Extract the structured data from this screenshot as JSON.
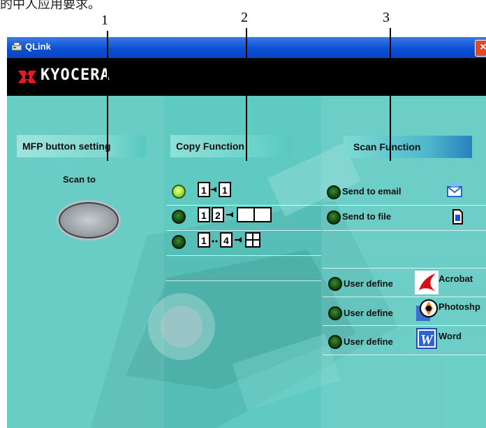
{
  "annotations": {
    "top_text": "的中人应用要求。",
    "callouts": [
      "1",
      "2",
      "3"
    ]
  },
  "window": {
    "title": "QLink",
    "close_symbol": "×"
  },
  "brand": {
    "name": "KYOCERA"
  },
  "sections": {
    "mfp": {
      "header": "MFP button setting",
      "scan_label": "Scan to"
    },
    "copy": {
      "header": "Copy Function",
      "items": [
        {
          "name": "copy-1-to-1",
          "state": "on"
        },
        {
          "name": "copy-2-in-1",
          "state": "off"
        },
        {
          "name": "copy-4-in-1",
          "state": "off"
        }
      ],
      "icon_digits": {
        "one": "1",
        "two": "2",
        "four": "4"
      }
    },
    "scan": {
      "header": "Scan Function",
      "items": [
        {
          "label": "Send to email",
          "icon": "email-scan-icon"
        },
        {
          "label": "Send to file",
          "icon": "file-icon"
        }
      ],
      "user_defines": [
        {
          "label": "User define",
          "app": "Acrobat",
          "icon": "acrobat-icon"
        },
        {
          "label": "User define",
          "app": "Photoshp",
          "icon": "photoshop-icon"
        },
        {
          "label": "User define",
          "app": "Word",
          "icon": "word-icon"
        }
      ]
    }
  },
  "colors": {
    "panel": "#58c8c0",
    "titlebar": "#0a4fd6",
    "brand_bar": "#000000",
    "brand_red": "#e01b22"
  }
}
